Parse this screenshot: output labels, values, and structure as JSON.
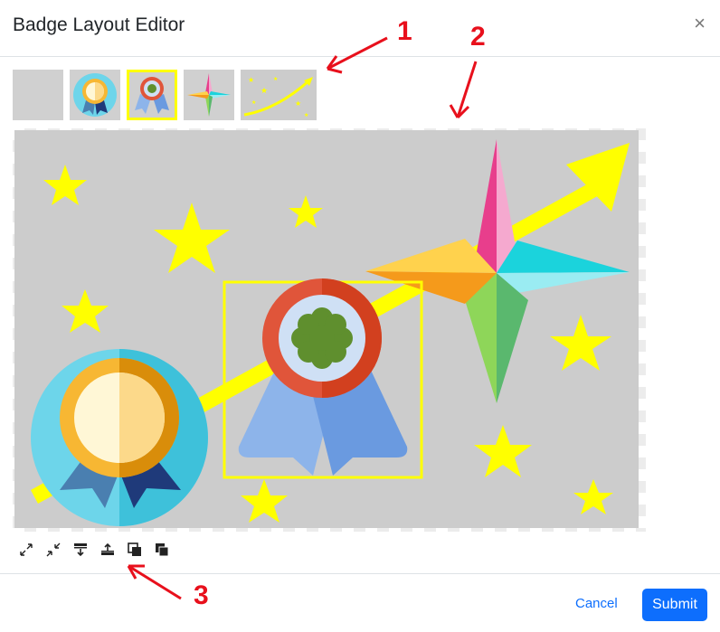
{
  "dialog": {
    "title": "Badge Layout Editor",
    "close_label": "×"
  },
  "thumbnails": [
    {
      "name": "blank-layer",
      "selected": false
    },
    {
      "name": "medal-badge",
      "selected": false
    },
    {
      "name": "rosette-badge",
      "selected": true
    },
    {
      "name": "compass-star",
      "selected": false
    },
    {
      "name": "stars-arrow-background",
      "selected": false
    }
  ],
  "toolbar": {
    "tools": [
      {
        "icon": "expand-icon"
      },
      {
        "icon": "shrink-icon"
      },
      {
        "icon": "send-backward-icon"
      },
      {
        "icon": "bring-forward-icon"
      },
      {
        "icon": "send-to-back-icon"
      },
      {
        "icon": "bring-to-front-icon"
      }
    ]
  },
  "footer": {
    "cancel_label": "Cancel",
    "submit_label": "Submit"
  },
  "annotations": {
    "label_1": "1",
    "label_2": "2",
    "label_3": "3"
  },
  "colors": {
    "canvas_bg": "#cccccc",
    "selection": "#ffff00",
    "primary": "#0d6efd",
    "annotation": "#e8101c"
  }
}
